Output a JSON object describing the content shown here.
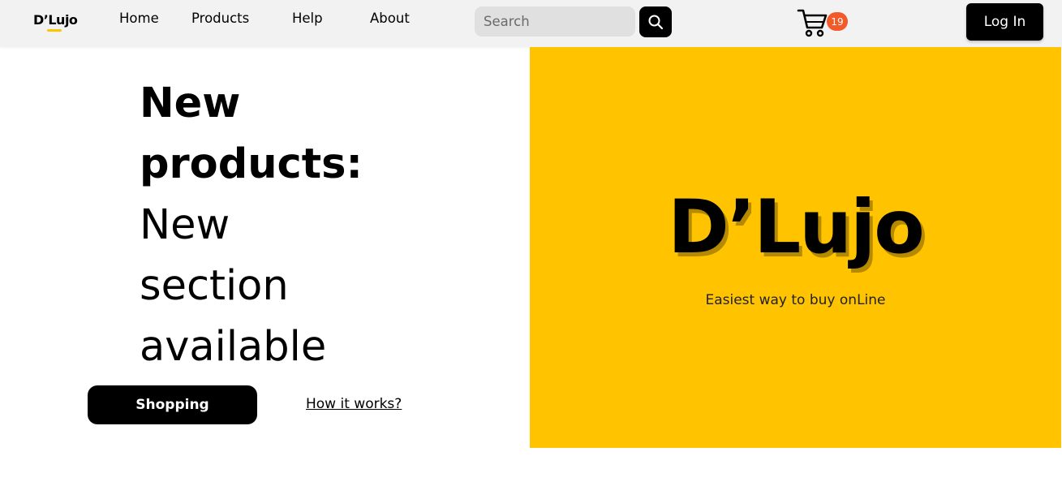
{
  "header": {
    "logo": "D’Lujo",
    "nav": {
      "home": "Home",
      "products": "Products",
      "help": "Help",
      "about": "About"
    },
    "search": {
      "placeholder": "Search",
      "icon": "search-icon"
    },
    "cart": {
      "icon": "shopping-cart-icon",
      "count": "19"
    },
    "login_label": "Log In"
  },
  "hero": {
    "heading_bold_1": "New",
    "heading_bold_2": "products:",
    "heading_light_1": "New",
    "heading_light_2": "section",
    "heading_light_3": "available",
    "shop_button": "Shopping",
    "how_link": "How it works?"
  },
  "promo": {
    "title": "D’Lujo",
    "subtitle": "Easiest way to buy onLine"
  },
  "colors": {
    "accent": "#ffc300",
    "badge": "#f25a2a",
    "header_bg": "#f2f2f2",
    "button_bg": "#000000"
  }
}
